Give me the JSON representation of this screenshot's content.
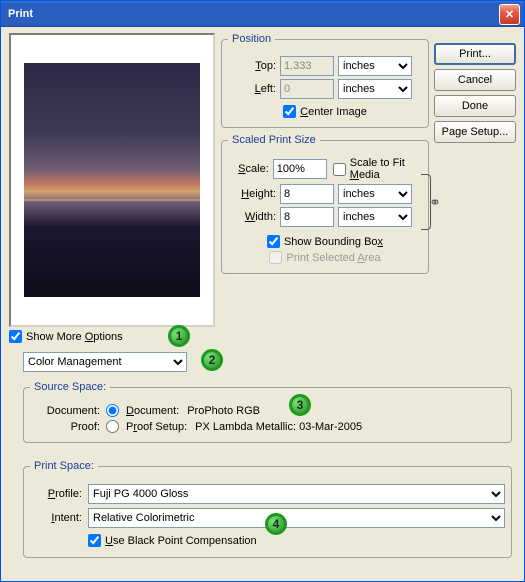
{
  "window": {
    "title": "Print"
  },
  "buttons": {
    "print": "Print...",
    "cancel": "Cancel",
    "done": "Done",
    "page_setup": "Page Setup..."
  },
  "position": {
    "legend": "Position",
    "top_label": "Top:",
    "top_value": "1.333",
    "top_units": "inches",
    "left_label": "Left:",
    "left_value": "0",
    "left_units": "inches",
    "center_image": "Center Image",
    "center_checked": true
  },
  "scaled": {
    "legend": "Scaled Print Size",
    "scale_label": "Scale:",
    "scale_value": "100%",
    "fit_media": "Scale to Fit Media",
    "height_label": "Height:",
    "height_value": "8",
    "height_units": "inches",
    "width_label": "Width:",
    "width_value": "8",
    "width_units": "inches",
    "show_bbox": "Show Bounding Box",
    "show_bbox_checked": true,
    "print_sel": "Print Selected Area"
  },
  "more_options": {
    "label": "Show More Options",
    "checked": true
  },
  "mode_select": "Color Management",
  "source": {
    "legend": "Source Space:",
    "doc_label": "Document:",
    "doc_radio": "Document:",
    "doc_value": "ProPhoto RGB",
    "proof_label": "Proof:",
    "proof_radio": "Proof Setup:",
    "proof_value": "PX Lambda Metallic: 03-Mar-2005"
  },
  "print_space": {
    "legend": "Print Space:",
    "profile_label": "Profile:",
    "profile_value": "Fuji PG 4000 Gloss",
    "intent_label": "Intent:",
    "intent_value": "Relative Colorimetric",
    "bpc": "Use Black Point Compensation",
    "bpc_checked": true
  },
  "bubbles": {
    "b1": "1",
    "b2": "2",
    "b3": "3",
    "b4": "4"
  }
}
